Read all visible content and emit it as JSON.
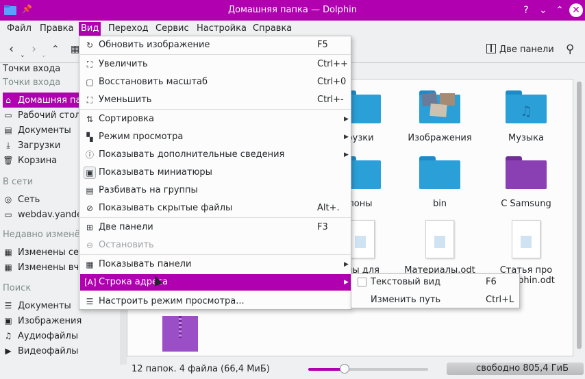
{
  "window": {
    "title": "Домашняя папка — Dolphin",
    "buttons": {
      "help": "?",
      "minimize": "⌄",
      "maximize": "⌃",
      "close": "✕"
    }
  },
  "menubar": [
    "Файл",
    "Правка",
    "Вид",
    "Переход",
    "Сервис",
    "Настройка",
    "Справка"
  ],
  "toolbar": {
    "two_panels": "Две панели"
  },
  "sidebar": {
    "title": "Точки входа",
    "sections": [
      {
        "header": "Точки входа",
        "items": [
          {
            "label": "Домашняя папка",
            "icon": "home-icon"
          },
          {
            "label": "Рабочий стол",
            "icon": "desktop-icon"
          },
          {
            "label": "Документы",
            "icon": "documents-icon"
          },
          {
            "label": "Загрузки",
            "icon": "downloads-icon"
          },
          {
            "label": "Корзина",
            "icon": "trash-icon"
          }
        ]
      },
      {
        "header": "В сети",
        "items": [
          {
            "label": "Сеть",
            "icon": "network-icon"
          },
          {
            "label": "webdav.yandex.ru",
            "icon": "folder-icon"
          }
        ]
      },
      {
        "header": "Недавно изменённые",
        "items": [
          {
            "label": "Изменены сегодня",
            "icon": "calendar-icon"
          },
          {
            "label": "Изменены вчера",
            "icon": "calendar-icon"
          }
        ]
      },
      {
        "header": "Поиск",
        "items": [
          {
            "label": "Документы",
            "icon": "documents-icon"
          },
          {
            "label": "Изображения",
            "icon": "images-icon"
          },
          {
            "label": "Аудиофайлы",
            "icon": "audio-icon"
          },
          {
            "label": "Видеофайлы",
            "icon": "video-icon"
          }
        ]
      }
    ]
  },
  "files": [
    {
      "label": "рузки",
      "kind": "folder"
    },
    {
      "label": "Изображения",
      "kind": "folder"
    },
    {
      "label": "Музыка",
      "kind": "folder"
    },
    {
      "label": "лоны",
      "kind": "folder"
    },
    {
      "label": "bin",
      "kind": "folder"
    },
    {
      "label": "C Samsung",
      "kind": "folder"
    },
    {
      "label": "алы для",
      "kind": "document"
    },
    {
      "label": "Материалы.odt",
      "kind": "document"
    },
    {
      "label": "Статья про",
      "label2": "phin.odt",
      "kind": "document"
    }
  ],
  "statusbar": {
    "summary": "12 папок. 4 файла (66,4 МиБ)",
    "free_space": "свободно 805,4 ГиБ",
    "zoom_fraction": 0.3
  },
  "view_menu": {
    "items": [
      {
        "label": "Обновить изображение",
        "shortcut": "F5",
        "icon": "refresh-icon"
      },
      {
        "label": "Увеличить",
        "shortcut": "Ctrl++",
        "icon": "zoom-in-icon"
      },
      {
        "label": "Восстановить масштаб",
        "shortcut": "Ctrl+0",
        "icon": "zoom-reset-icon"
      },
      {
        "label": "Уменьшить",
        "shortcut": "Ctrl+-",
        "icon": "zoom-out-icon"
      },
      {
        "label": "Сортировка",
        "shortcut": "",
        "icon": "sort-icon"
      },
      {
        "label": "Режим просмотра",
        "shortcut": "",
        "icon": "view-mode-icon"
      },
      {
        "label": "Показывать дополнительные сведения",
        "shortcut": "",
        "icon": "info-icon"
      },
      {
        "label": "Показывать миниатюры",
        "shortcut": "",
        "icon": "thumbnail-icon"
      },
      {
        "label": "Разбивать на группы",
        "shortcut": "",
        "icon": "groups-icon"
      },
      {
        "label": "Показывать скрытые файлы",
        "shortcut": "Alt+.",
        "icon": "hidden-files-icon"
      },
      {
        "label": "Две панели",
        "shortcut": "F3",
        "icon": "split-view-icon"
      },
      {
        "label": "Остановить",
        "shortcut": "",
        "icon": "stop-icon"
      },
      {
        "label": "Показывать панели",
        "shortcut": "",
        "icon": "panels-icon"
      },
      {
        "label": "Строка адреса",
        "shortcut": "",
        "icon": "address-bar-icon"
      },
      {
        "label": "Настроить режим просмотра...",
        "shortcut": "",
        "icon": "configure-view-icon"
      }
    ]
  },
  "address_submenu": [
    {
      "label": "Текстовый вид",
      "shortcut": "F6"
    },
    {
      "label": "Изменить путь",
      "shortcut": "Ctrl+L"
    }
  ],
  "colors": {
    "accent": "#b000b0",
    "folder_blue": "#2a9fd8",
    "folder_purple": "#8a3fb3"
  }
}
